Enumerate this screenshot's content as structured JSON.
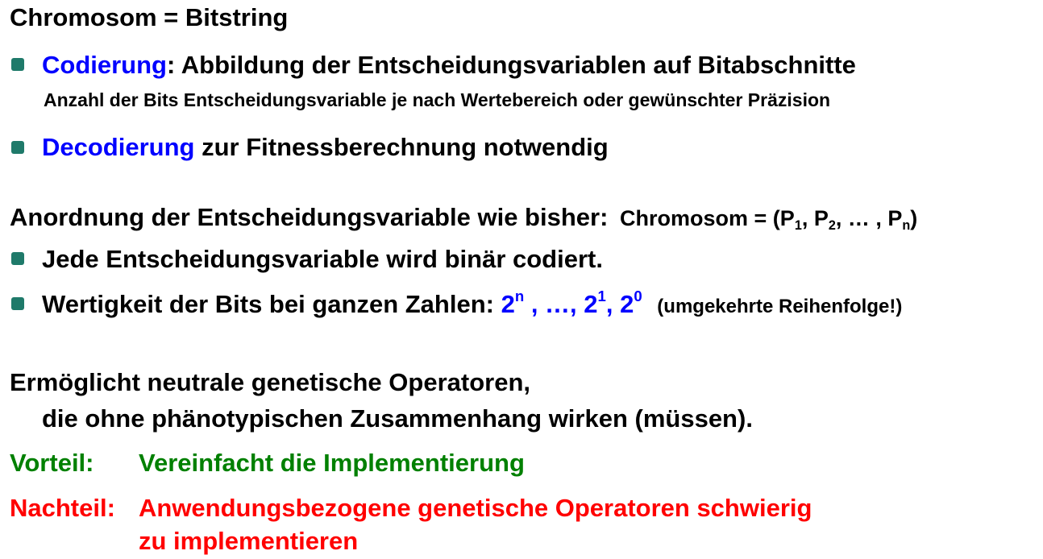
{
  "slide": {
    "heading1": "Chromosom = Bitstring",
    "bullet1": {
      "term": "Codierung",
      "rest": ": Abbildung der Entscheidungsvariablen auf Bitabschnitte",
      "sub": "Anzahl der Bits Entscheidungsvariable je nach Wertebereich oder gewünschter Präzision"
    },
    "bullet2": {
      "term": "Decodierung",
      "rest": " zur Fitnessberechnung notwendig"
    },
    "heading2": {
      "main": "Anordnung der Entscheidungsvariable wie bisher:",
      "formula_prefix": "Chromosom = (P",
      "s1": "1",
      "sep1": ", P",
      "s2": "2",
      "sep2": ", … , P",
      "sn": "n",
      "close": ")"
    },
    "bullet3": "Jede Entscheidungsvariable wird binär codiert.",
    "bullet4": {
      "text": "Wertigkeit der Bits bei ganzen Zahlen: ",
      "b1": "2",
      "e1": "n",
      "mid": " , …, 2",
      "e2": "1",
      "mid2": ", 2",
      "e3": "0",
      "note": "(umgekehrte Reihenfolge!)"
    },
    "para1_line1": "Ermöglicht neutrale genetische Operatoren,",
    "para1_line2": "die ohne phänotypischen Zusammenhang wirken (müssen).",
    "vorteil_label": "Vorteil:",
    "vorteil_text": "Vereinfacht die Implementierung",
    "nachteil_label": "Nachteil:",
    "nachteil_text1": "Anwendungsbezogene genetische Operatoren schwierig",
    "nachteil_text2": "zu implementieren",
    "colors": {
      "blue": "#0000ff",
      "green": "#008000",
      "red": "#ff0000",
      "bullet": "#1f7a6a"
    }
  }
}
